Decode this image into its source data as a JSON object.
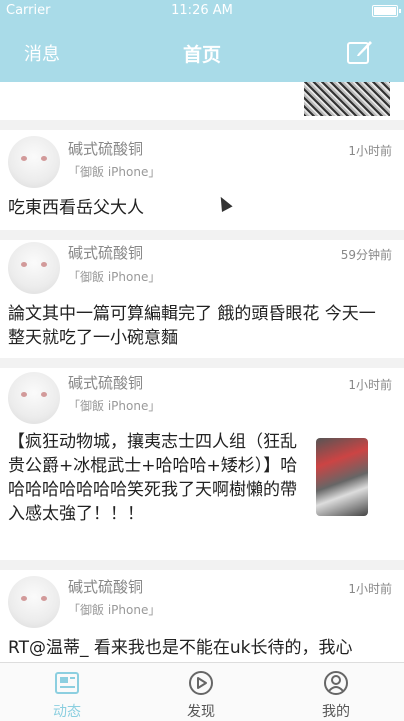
{
  "status_bar": {
    "carrier": "Carrier",
    "time": "11:26 AM"
  },
  "nav": {
    "left_label": "消息",
    "title": "首页"
  },
  "colors": {
    "accent": "#a9dbe8",
    "tab_active": "#8ccfe0"
  },
  "posts": [
    {
      "author": "碱式硫酸铜",
      "source": "「御飯 iPhone」",
      "time": "1小时前",
      "content": "吃東西看岳父大人"
    },
    {
      "author": "碱式硫酸铜",
      "source": "「御飯 iPhone」",
      "time": "59分钟前",
      "content": "論文其中一篇可算編輯完了 餓的頭昏眼花 今天一整天就吃了一小碗意麵"
    },
    {
      "author": "碱式硫酸铜",
      "source": "「御飯 iPhone」",
      "time": "1小时前",
      "content": "【疯狂动物城，攘夷志士四人组（狂乱贵公爵+冰棍武士+哈哈哈+矮杉）】哈哈哈哈哈哈哈哈笑死我了天啊樹懶的帶入感太強了！！！"
    },
    {
      "author": "碱式硫酸铜",
      "source": "「御飯 iPhone」",
      "time": "1小时前",
      "content": "RT@温蒂_ 看来我也是不能在uk长待的，我心"
    }
  ],
  "tabs": [
    {
      "label": "动态",
      "icon": "feed-icon",
      "active": true
    },
    {
      "label": "发现",
      "icon": "play-circle-icon",
      "active": false
    },
    {
      "label": "我的",
      "icon": "profile-icon",
      "active": false
    }
  ]
}
